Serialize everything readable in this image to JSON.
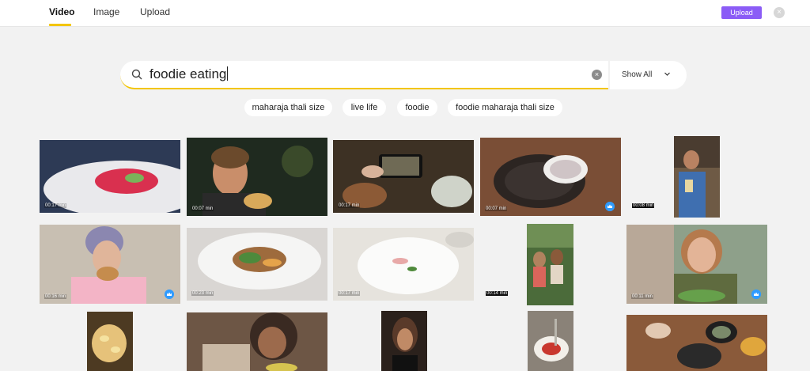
{
  "tabs": [
    {
      "label": "Video",
      "active": true
    },
    {
      "label": "Image",
      "active": false
    },
    {
      "label": "Upload",
      "active": false
    }
  ],
  "header": {
    "upload_label": "Upload",
    "close_glyph": "×"
  },
  "search": {
    "value": "foodie eating",
    "clear_glyph": "×"
  },
  "filter": {
    "label": "Show All"
  },
  "chips": [
    "maharaja thali size",
    "live life",
    "foodie",
    "foodie maharaja thali size"
  ],
  "results": [
    {
      "duration": "00:17 min",
      "premium": false
    },
    {
      "duration": "00:07 min",
      "premium": false
    },
    {
      "duration": "00:17 min",
      "premium": false
    },
    {
      "duration": "00:07 min",
      "premium": true
    },
    {
      "duration": "00:08 min",
      "premium": false
    },
    {
      "duration": "00:16 min",
      "premium": true
    },
    {
      "duration": "00:23 min",
      "premium": false
    },
    {
      "duration": "00:17 min",
      "premium": false
    },
    {
      "duration": "00:14 min",
      "premium": false
    },
    {
      "duration": "00:11 min",
      "premium": true
    },
    {
      "duration": "",
      "premium": false
    },
    {
      "duration": "",
      "premium": false
    },
    {
      "duration": "",
      "premium": false
    },
    {
      "duration": "",
      "premium": false
    },
    {
      "duration": "",
      "premium": false
    }
  ],
  "colors": {
    "accent": "#f3c500",
    "upload_button": "#8b5cf6",
    "premium_badge": "#2f9bff"
  }
}
